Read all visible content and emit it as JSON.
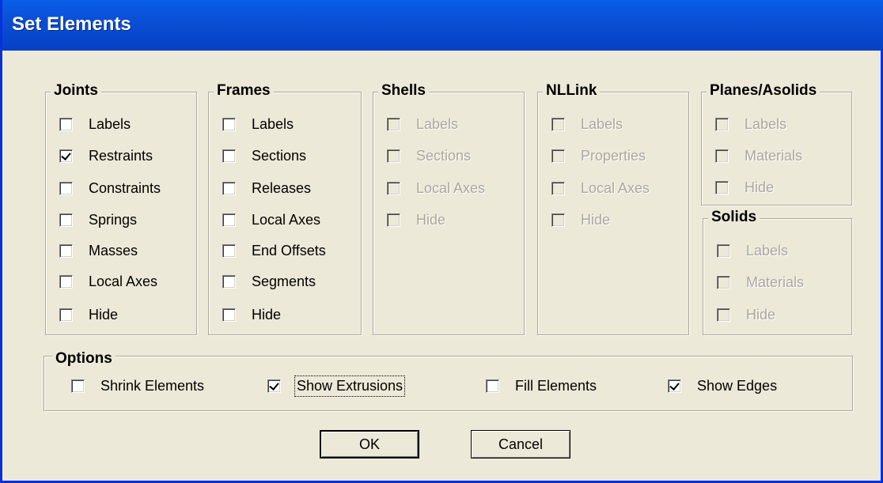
{
  "window": {
    "title": "Set Elements"
  },
  "groups": {
    "joints": {
      "title": "Joints",
      "items": [
        {
          "label": "Labels",
          "checked": false
        },
        {
          "label": "Restraints",
          "checked": true
        },
        {
          "label": "Constraints",
          "checked": false
        },
        {
          "label": "Springs",
          "checked": false
        },
        {
          "label": "Masses",
          "checked": false
        },
        {
          "label": "Local Axes",
          "checked": false
        },
        {
          "label": "Hide",
          "checked": false
        }
      ]
    },
    "frames": {
      "title": "Frames",
      "items": [
        {
          "label": "Labels",
          "checked": false
        },
        {
          "label": "Sections",
          "checked": false
        },
        {
          "label": "Releases",
          "checked": false
        },
        {
          "label": "Local Axes",
          "checked": false
        },
        {
          "label": "End Offsets",
          "checked": false
        },
        {
          "label": "Segments",
          "checked": false
        },
        {
          "label": "Hide",
          "checked": false
        }
      ]
    },
    "shells": {
      "title": "Shells",
      "items": [
        {
          "label": "Labels"
        },
        {
          "label": "Sections"
        },
        {
          "label": "Local Axes"
        },
        {
          "label": "Hide"
        }
      ]
    },
    "nllink": {
      "title": "NLLink",
      "items": [
        {
          "label": "Labels"
        },
        {
          "label": "Properties"
        },
        {
          "label": "Local Axes"
        },
        {
          "label": "Hide"
        }
      ]
    },
    "planes": {
      "title": "Planes/Asolids",
      "items": [
        {
          "label": "Labels"
        },
        {
          "label": "Materials"
        },
        {
          "label": "Hide"
        }
      ]
    },
    "solids": {
      "title": "Solids",
      "items": [
        {
          "label": "Labels"
        },
        {
          "label": "Materials"
        },
        {
          "label": "Hide"
        }
      ]
    }
  },
  "options": {
    "title": "Options",
    "items": [
      {
        "label": "Shrink Elements",
        "checked": false
      },
      {
        "label": "Show Extrusions",
        "checked": true
      },
      {
        "label": "Fill Elements",
        "checked": false
      },
      {
        "label": "Show Edges",
        "checked": true
      }
    ]
  },
  "buttons": {
    "ok": "OK",
    "cancel": "Cancel"
  }
}
